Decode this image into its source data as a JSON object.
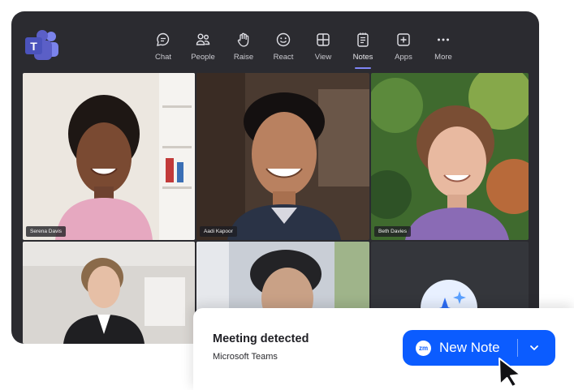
{
  "toolbar": {
    "items": [
      {
        "label": "Chat",
        "icon": "chat-icon"
      },
      {
        "label": "People",
        "icon": "people-icon"
      },
      {
        "label": "Raise",
        "icon": "hand-icon"
      },
      {
        "label": "React",
        "icon": "smiley-icon"
      },
      {
        "label": "View",
        "icon": "grid-icon"
      },
      {
        "label": "Notes",
        "icon": "notes-icon"
      },
      {
        "label": "Apps",
        "icon": "plus-box-icon"
      },
      {
        "label": "More",
        "icon": "more-dots-icon"
      }
    ],
    "active": "Notes"
  },
  "participants": [
    {
      "name": "Serena Davis"
    },
    {
      "name": "Aadi Kapoor"
    },
    {
      "name": "Beth Davies"
    },
    {
      "name": ""
    },
    {
      "name": ""
    }
  ],
  "popup": {
    "title": "Meeting detected",
    "subtitle": "Microsoft Teams",
    "button_badge": "zm",
    "button_label": "New Note"
  },
  "colors": {
    "accent": "#0b5cff",
    "teams_purple": "#5b5fc7",
    "window_bg": "#2b2b30"
  }
}
